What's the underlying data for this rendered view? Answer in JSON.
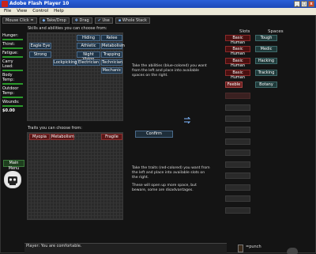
{
  "window": {
    "title": "Adobe Flash Player 10",
    "minimize": "_",
    "maximize": "□",
    "close": "x"
  },
  "menubar": [
    "File",
    "View",
    "Control",
    "Help"
  ],
  "toolbar": {
    "mouse_click": "Mouse Click =",
    "take_drop": "Take/Drop",
    "drag": "Drag",
    "use": "Use",
    "whole_stack": "Whole Stack"
  },
  "sidebar": {
    "stats": [
      "Hunger:",
      "Thirst:",
      "Fatigue:",
      "Carry Load:",
      "Body Temp:",
      "Outdoor Temp:",
      "Wounds:"
    ],
    "money": "$0.00"
  },
  "main_menu": "Main Menu",
  "skills": {
    "title": "Skills and abilities you can choose from:",
    "items": [
      "Hiding",
      "Relee",
      "Eagle Eye",
      "Athletic",
      "Metabolism",
      "Strong",
      "Night Vision",
      "Trapping",
      "Lockpicking",
      "Electrician",
      "Technician",
      "Mechanic"
    ]
  },
  "traits": {
    "title": "Traits you can choose from:",
    "items": [
      "Myopia",
      "Metabolism",
      "Fragile"
    ]
  },
  "info": {
    "abilities": "Take the abilities (blue-colored) you want from the left and place into available spaces on the right.",
    "traits_1": "Take the traits (red-colored) you want from the left and place into available slots on the right.",
    "traits_2": "These will open up more space, but beware, some are disadvantages."
  },
  "confirm": "Confirm",
  "slots": {
    "heading": "Slots",
    "items": [
      "Basic Human",
      "Basic Human",
      "Basic Human",
      "Basic Human",
      "Feeble"
    ]
  },
  "spaces": {
    "heading": "Spaces",
    "items": [
      "Tough",
      "Medic",
      "Hacking",
      "Tracking",
      "Botany"
    ]
  },
  "status": {
    "message": "Player: You are comfortable."
  },
  "action": {
    "label": "=punch"
  },
  "colors": {
    "titlebar": "#2a5fd8",
    "ability": "#1e3346",
    "trait": "#5a1616",
    "space": "#1f3a3a",
    "bar": "#2a9a2a"
  }
}
